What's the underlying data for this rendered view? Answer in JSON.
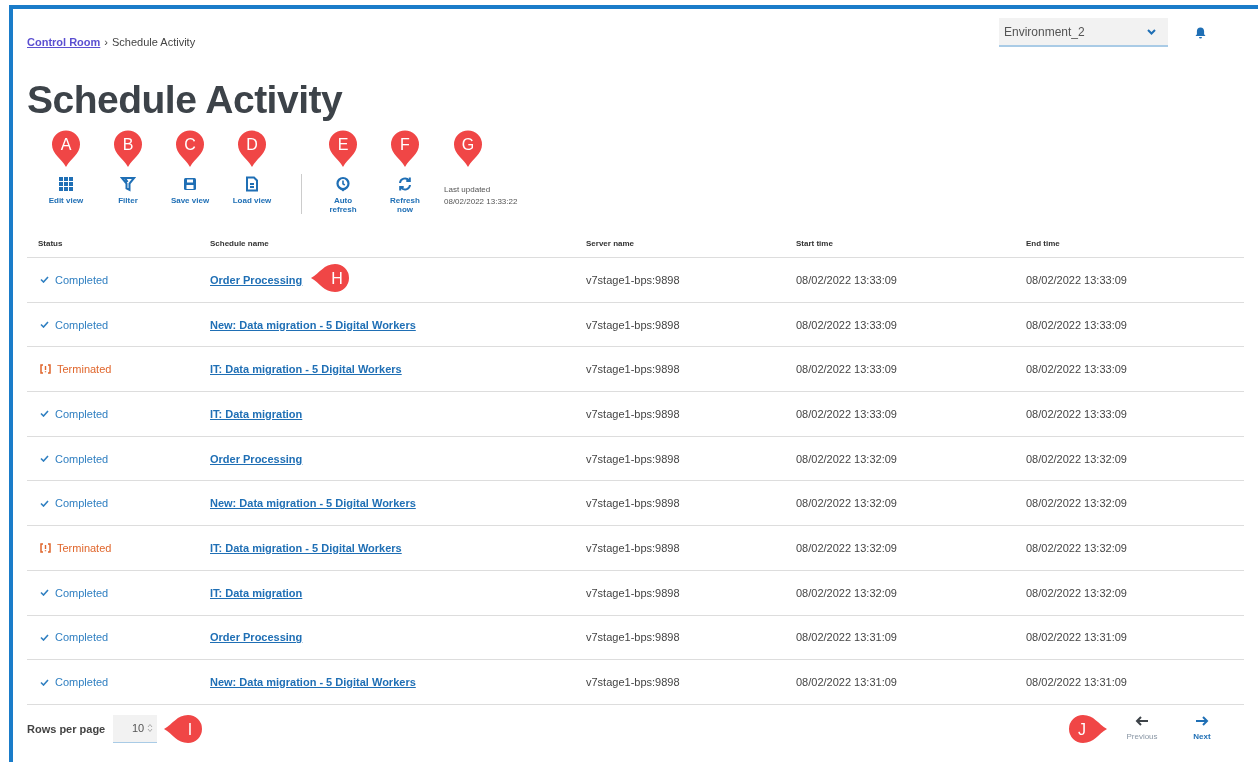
{
  "breadcrumb": {
    "link": "Control Room",
    "separator": "›",
    "current": "Schedule Activity"
  },
  "environment_select": {
    "value": "Environment_2"
  },
  "title": "Schedule Activity",
  "toolbar": [
    {
      "kind": "grid",
      "label": "Edit view",
      "callout": "A"
    },
    {
      "kind": "filter",
      "label": "Filter",
      "callout": "B"
    },
    {
      "kind": "save",
      "label": "Save view",
      "callout": "C"
    },
    {
      "kind": "load",
      "label": "Load view",
      "callout": "D"
    },
    {
      "kind": "auto",
      "label": "Auto refresh",
      "callout": "E"
    },
    {
      "kind": "refresh",
      "label": "Refresh now",
      "callout": "F"
    }
  ],
  "last_updated": {
    "label": "Last updated",
    "value": "08/02/2022 13:33:22",
    "callout": "G"
  },
  "table": {
    "columns": [
      "Status",
      "Schedule name",
      "Server name",
      "Start time",
      "End time"
    ],
    "rows": [
      {
        "kind": "completed",
        "status": "Completed",
        "name": "Order Processing",
        "server": "v7stage1-bps:9898",
        "start": "08/02/2022 13:33:09",
        "end": "08/02/2022 13:33:09",
        "callout": "H"
      },
      {
        "kind": "completed",
        "status": "Completed",
        "name": "New: Data migration - 5 Digital Workers",
        "server": "v7stage1-bps:9898",
        "start": "08/02/2022 13:33:09",
        "end": "08/02/2022 13:33:09"
      },
      {
        "kind": "terminated",
        "status": "Terminated",
        "name": "IT: Data migration - 5 Digital Workers",
        "server": "v7stage1-bps:9898",
        "start": "08/02/2022 13:33:09",
        "end": "08/02/2022 13:33:09"
      },
      {
        "kind": "completed",
        "status": "Completed",
        "name": "IT: Data migration",
        "server": "v7stage1-bps:9898",
        "start": "08/02/2022 13:33:09",
        "end": "08/02/2022 13:33:09"
      },
      {
        "kind": "completed",
        "status": "Completed",
        "name": "Order Processing",
        "server": "v7stage1-bps:9898",
        "start": "08/02/2022 13:32:09",
        "end": "08/02/2022 13:32:09"
      },
      {
        "kind": "completed",
        "status": "Completed",
        "name": "New: Data migration - 5 Digital Workers",
        "server": "v7stage1-bps:9898",
        "start": "08/02/2022 13:32:09",
        "end": "08/02/2022 13:32:09"
      },
      {
        "kind": "terminated",
        "status": "Terminated",
        "name": "IT: Data migration - 5 Digital Workers",
        "server": "v7stage1-bps:9898",
        "start": "08/02/2022 13:32:09",
        "end": "08/02/2022 13:32:09"
      },
      {
        "kind": "completed",
        "status": "Completed",
        "name": "IT: Data migration",
        "server": "v7stage1-bps:9898",
        "start": "08/02/2022 13:32:09",
        "end": "08/02/2022 13:32:09"
      },
      {
        "kind": "completed",
        "status": "Completed",
        "name": "Order Processing",
        "server": "v7stage1-bps:9898",
        "start": "08/02/2022 13:31:09",
        "end": "08/02/2022 13:31:09"
      },
      {
        "kind": "completed",
        "status": "Completed",
        "name": "New: Data migration - 5 Digital Workers",
        "server": "v7stage1-bps:9898",
        "start": "08/02/2022 13:31:09",
        "end": "08/02/2022 13:31:09"
      }
    ]
  },
  "rows_per_page": {
    "label": "Rows per page",
    "value": "10",
    "callout": "I"
  },
  "pagination": {
    "callout": "J",
    "buttons": [
      {
        "kind": "previous",
        "label": "Previous",
        "disabled": true
      },
      {
        "kind": "next",
        "label": "Next",
        "disabled": false
      }
    ]
  }
}
